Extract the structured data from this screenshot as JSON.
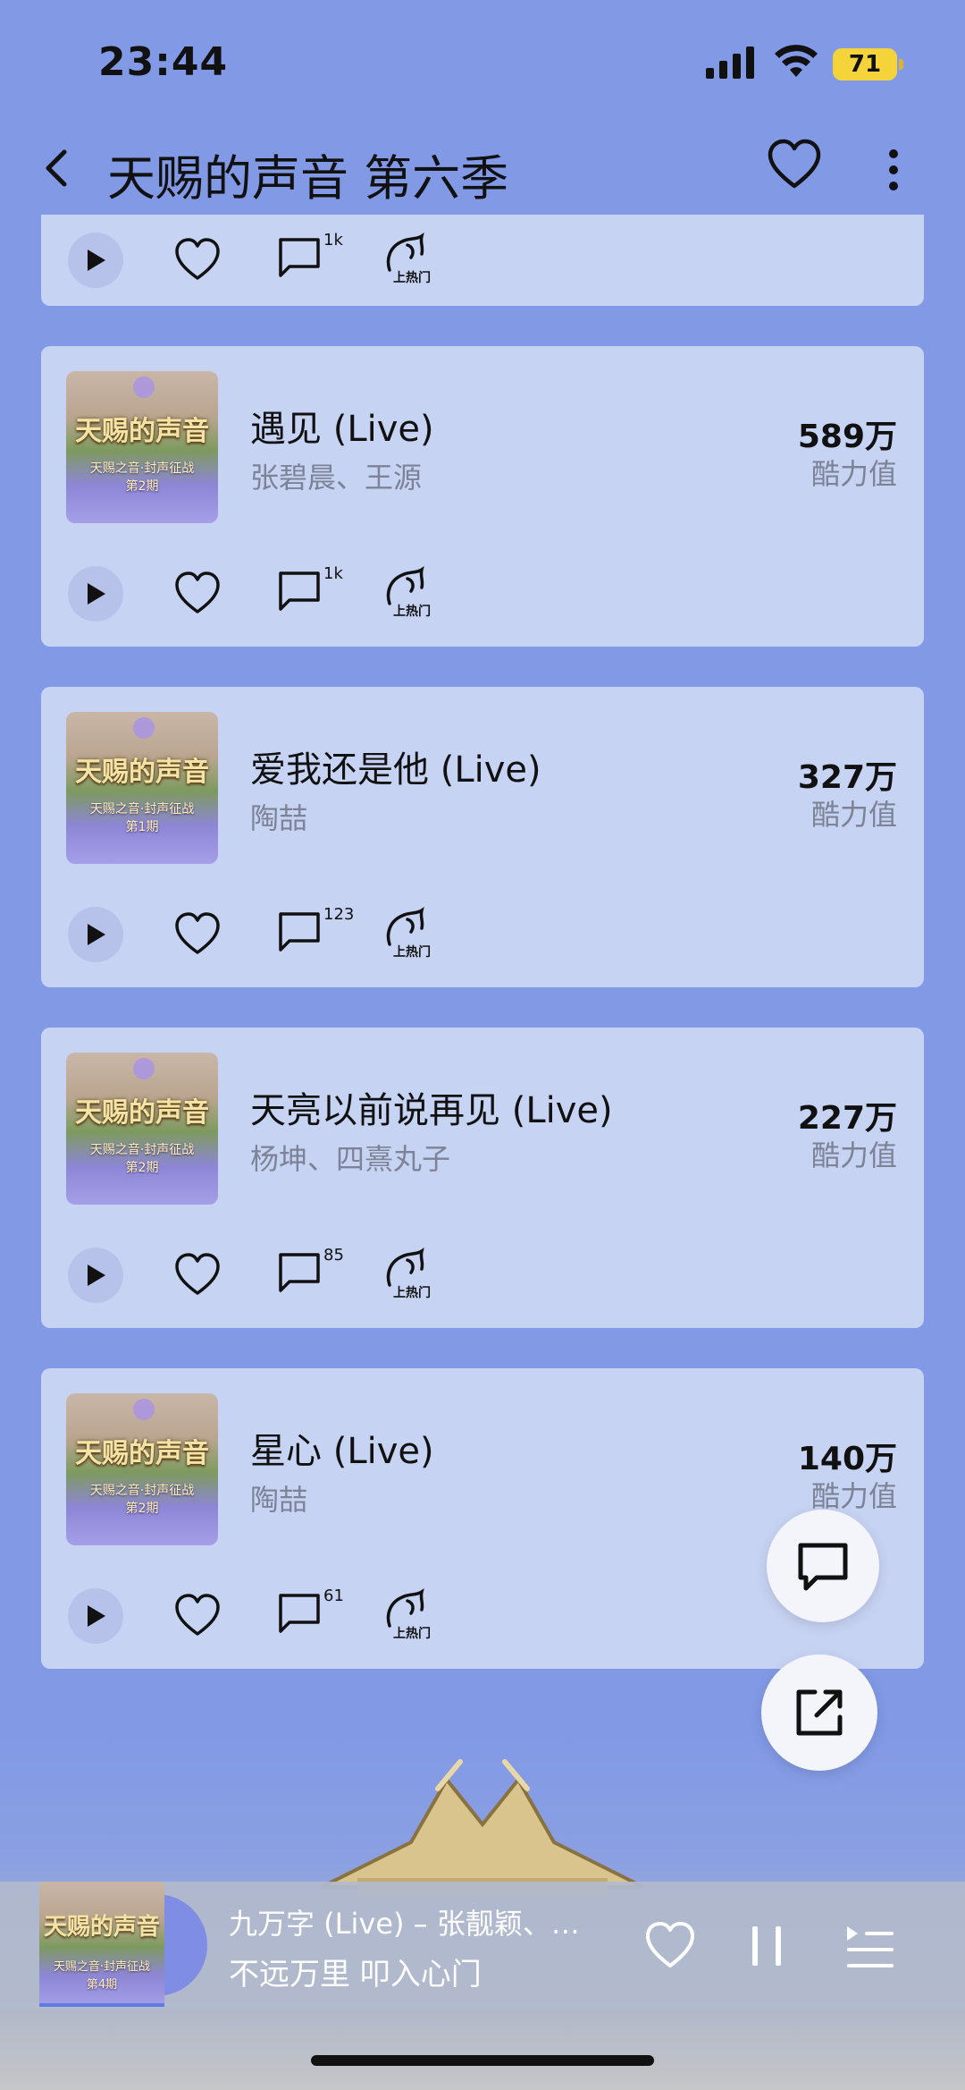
{
  "status_bar": {
    "time": "23:44",
    "battery": "71"
  },
  "header": {
    "title": "天赐的声音 第六季"
  },
  "partial_card": {
    "comment_count": "1k",
    "hot_label": "上热门"
  },
  "songs": [
    {
      "title": "遇见 (Live)",
      "artist": "张碧晨、王源",
      "score": "589万",
      "score_label": "酷力值",
      "comment_count": "1k",
      "hot_label": "上热门",
      "cover_logo": "天赐的声音",
      "cover_sub": "天赐之音·封声征战",
      "cover_ep": "第2期"
    },
    {
      "title": "爱我还是他 (Live)",
      "artist": "陶喆",
      "score": "327万",
      "score_label": "酷力值",
      "comment_count": "123",
      "hot_label": "上热门",
      "cover_logo": "天赐的声音",
      "cover_sub": "天赐之音·封声征战",
      "cover_ep": "第1期"
    },
    {
      "title": "天亮以前说再见 (Live)",
      "artist": "杨坤、四熹丸子",
      "score": "227万",
      "score_label": "酷力值",
      "comment_count": "85",
      "hot_label": "上热门",
      "cover_logo": "天赐的声音",
      "cover_sub": "天赐之音·封声征战",
      "cover_ep": "第2期"
    },
    {
      "title": "星心 (Live)",
      "artist": "陶喆",
      "score": "140万",
      "score_label": "酷力值",
      "comment_count": "61",
      "hot_label": "上热门",
      "cover_logo": "天赐的声音",
      "cover_sub": "天赐之音·封声征战",
      "cover_ep": "第2期"
    }
  ],
  "player": {
    "title": "九万字 (Live) – 张靓颖、…",
    "lyric": "不远万里 叩入心门",
    "cover_logo": "天赐的声音",
    "cover_sub": "天赐之音·封声征战",
    "cover_ep": "第4期"
  },
  "colors": {
    "background": "#8299e6",
    "card": "#c7d3f3",
    "battery": "#f5d33a"
  }
}
